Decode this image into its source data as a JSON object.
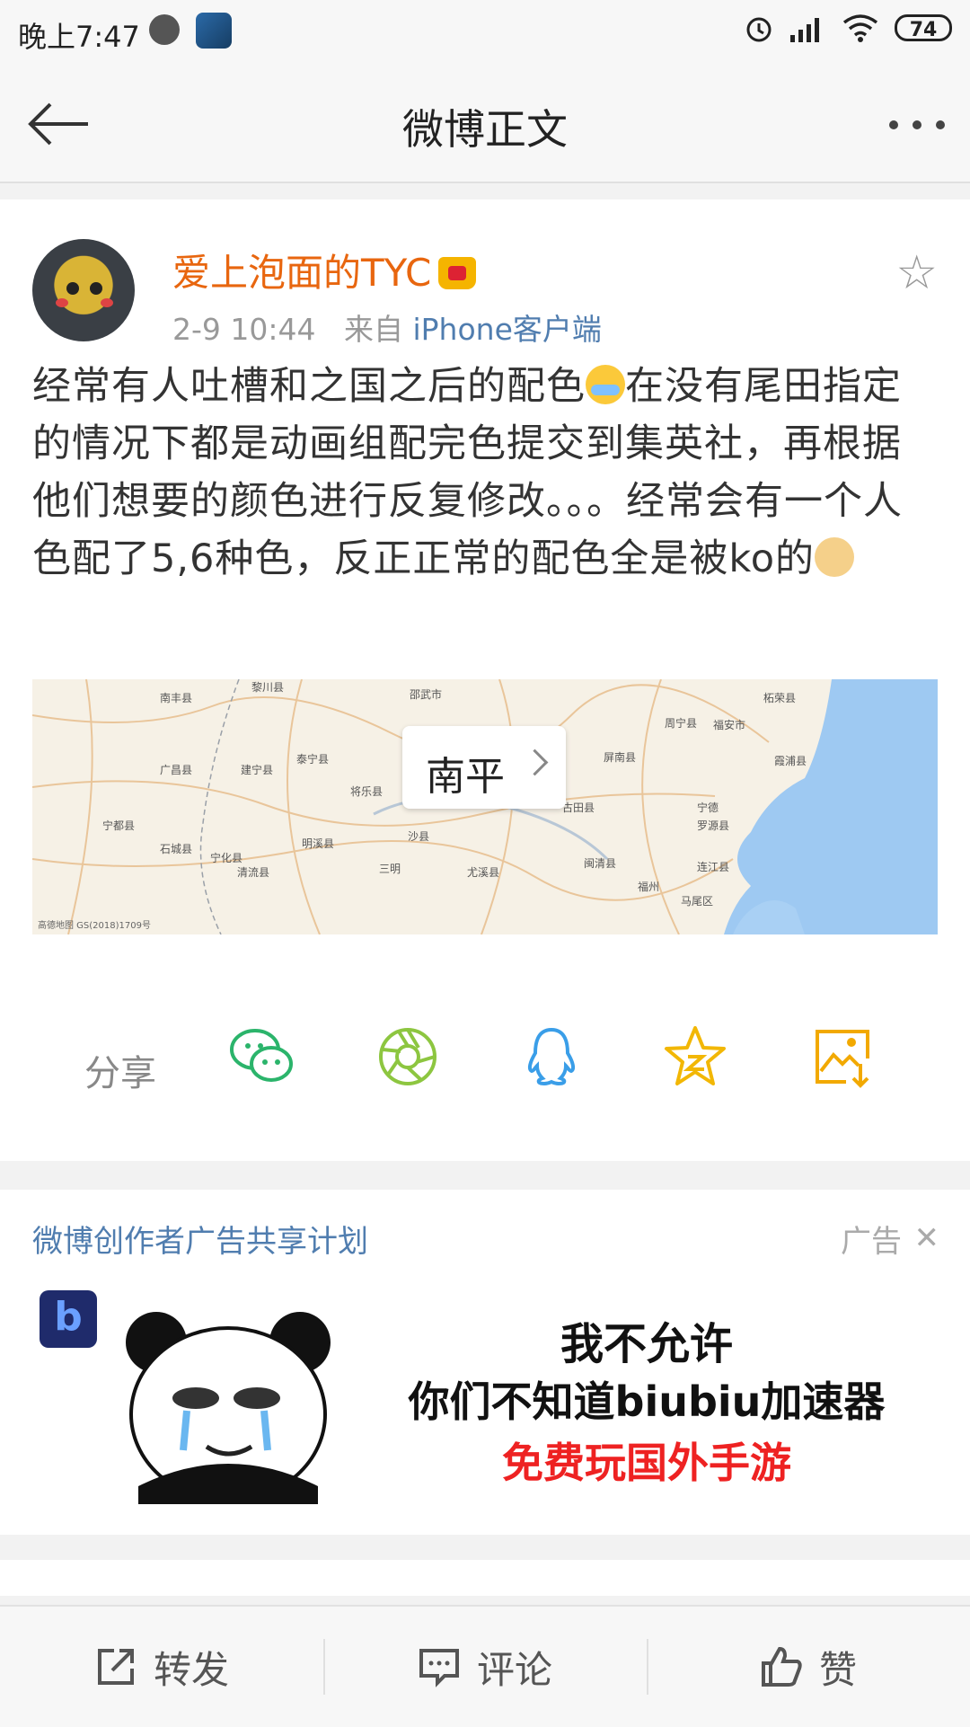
{
  "status": {
    "time": "晚上7:47",
    "battery": "74"
  },
  "header": {
    "title": "微博正文"
  },
  "post": {
    "username": "爱上泡面的TYC",
    "time": "2-9 10:44",
    "source_prefix": "来自",
    "source": "iPhone客户端",
    "text_1": "经常有人吐槽和之国之后的配色",
    "text_2": "在没有尾田指定的情况下都是动画组配完色提交到集英社，再根据他们想要的颜色进行反复修改。。。经常会有一个人色配了5,6种色，反正正常的配色全是被ko的",
    "map": {
      "location": "南平",
      "labels": [
        "南丰县",
        "黎川县",
        "邵武市",
        "周宁县",
        "柘荣县",
        "广昌县",
        "泰宁县",
        "建宁县",
        "将乐县",
        "屏南县",
        "福安市",
        "霞浦县",
        "宁都县",
        "古田县",
        "宁德",
        "罗源县",
        "石城县",
        "明溪县",
        "沙县",
        "宁化县",
        "清流县",
        "三明",
        "尤溪县",
        "闽清县",
        "连江县",
        "福州",
        "马尾区"
      ],
      "credit": "高德地图 GS(2018)1709号"
    }
  },
  "share": {
    "label": "分享"
  },
  "ad": {
    "title": "微博创作者广告共享计划",
    "tag": "广告",
    "line1": "我不允许",
    "line2": "你们不知道biubiu加速器",
    "line3": "免费玩国外手游"
  },
  "bottom": {
    "repost": "转发",
    "comment": "评论",
    "like": "赞"
  },
  "colors": {
    "accent_orange": "#e8660f",
    "link_blue": "#507daf",
    "ad_red": "#e22222"
  }
}
